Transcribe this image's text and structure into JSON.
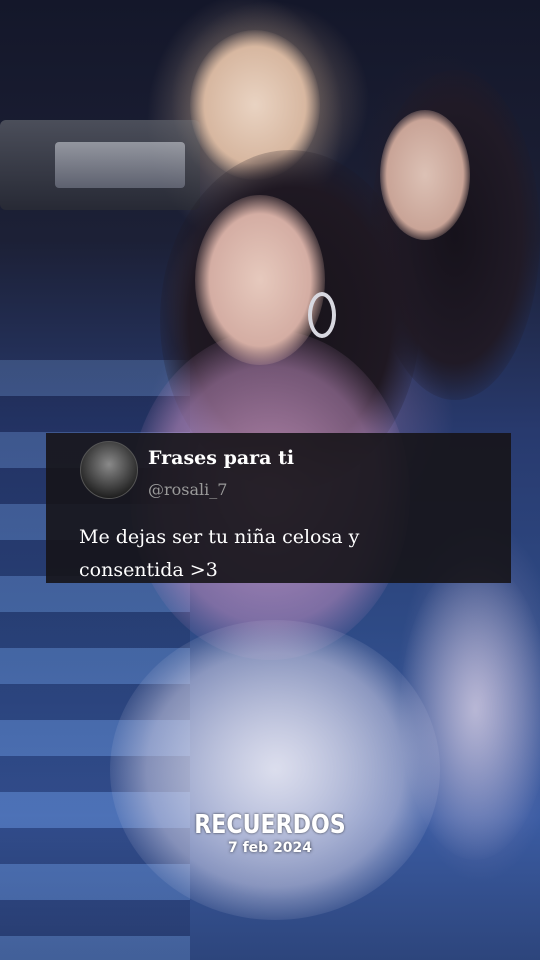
{
  "tweet": {
    "display_name": "Frases para ti",
    "handle": "@rosali_7",
    "text_lines": [
      "Me dejas ser tu niña celosa y",
      "consentida >3"
    ],
    "avatar_icon": "avatar-image-icon"
  },
  "overlay": {
    "title": "RECUERDOS",
    "date": "7 feb 2024"
  },
  "colors": {
    "card_background": "#161418",
    "text_primary": "#ffffff",
    "text_secondary": "#9a9a9a"
  }
}
